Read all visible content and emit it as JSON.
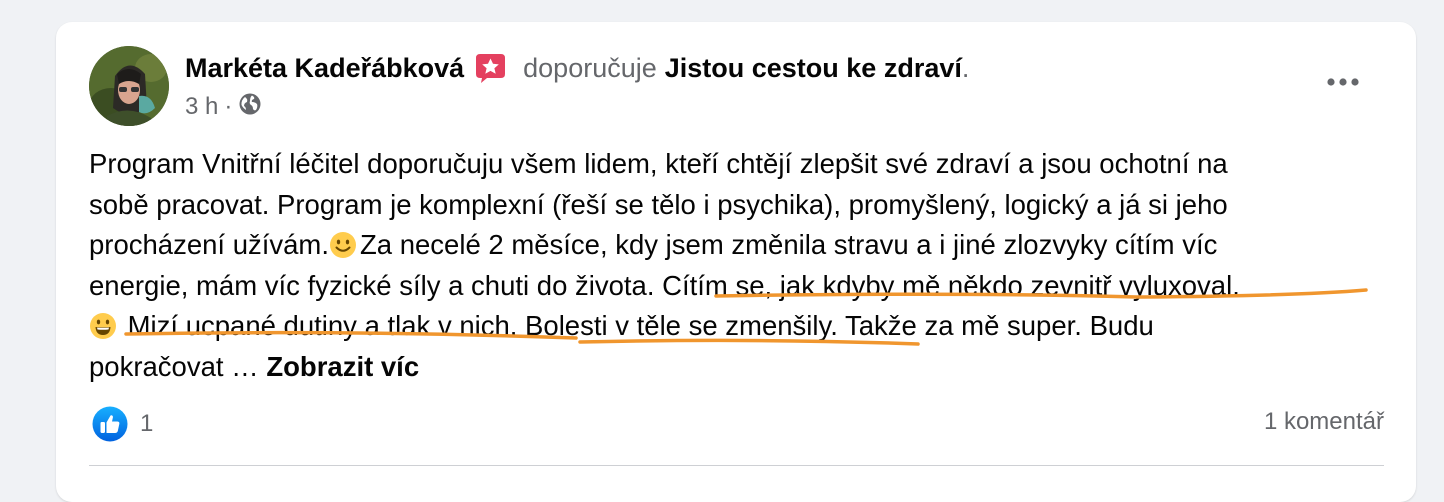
{
  "post": {
    "author": "Markéta Kadeřábková",
    "action": "doporučuje",
    "page_name": "Jistou cestou ke zdraví",
    "page_suffix": ".",
    "time": "3 h",
    "separator": "·",
    "audience_icon": "globe-icon",
    "badge_icon": "star-recommend-icon",
    "more_icon": "three-dots-icon",
    "text_lines": [
      "Program Vnitřní léčitel doporučuju všem lidem, kteří chtějí zlepšit své zdraví a jsou ochotní na",
      "sobě pracovat. Program je komplexní (řeší se tělo i psychika), promyšlený, logický a já si jeho",
      "procházení užívám.",
      "Za necelé 2 měsíce, kdy jsem změnila stravu a i jiné zlozvyky cítím víc",
      "energie, mám víc fyzické síly a chuti do života. Cítím se, jak kdyby mě někdo zevnitř vyluxoval.",
      " Mizí ucpané dutiny a tlak v nich. Bolesti v těle se zmenšily. Takže za mě super. Budu",
      "pokračovat … "
    ],
    "see_more": "Zobrazit víc",
    "emojis": [
      "slightly-smiling-face-emoji",
      "grinning-face-emoji"
    ],
    "reaction_icon": "like-icon",
    "reaction_count": "1",
    "comments": "1 komentář",
    "colors": {
      "accent": "#1877f2",
      "badge": "#e4405f",
      "annotation": "#f0962e",
      "secondary_text": "#65676b",
      "primary_text": "#050505"
    }
  }
}
